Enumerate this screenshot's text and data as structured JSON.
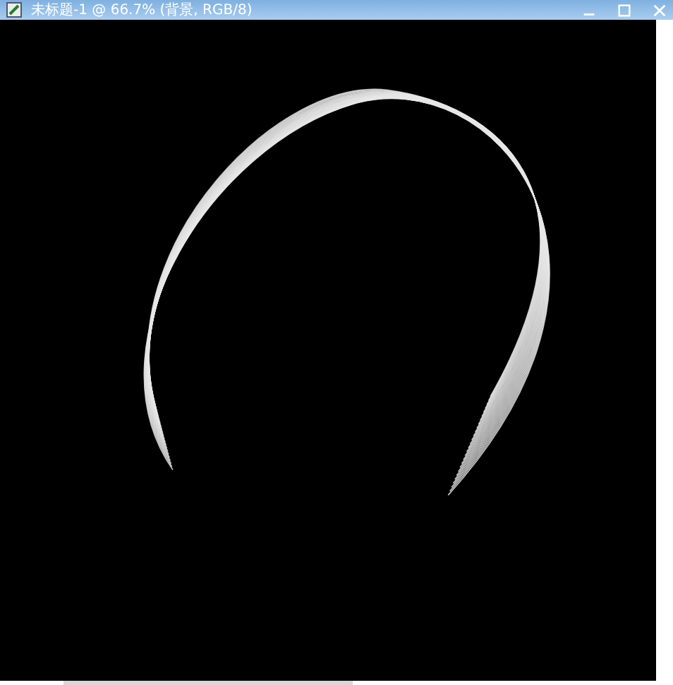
{
  "window": {
    "title": "未标题-1 @ 66.7% (背景, RGB/8)"
  }
}
